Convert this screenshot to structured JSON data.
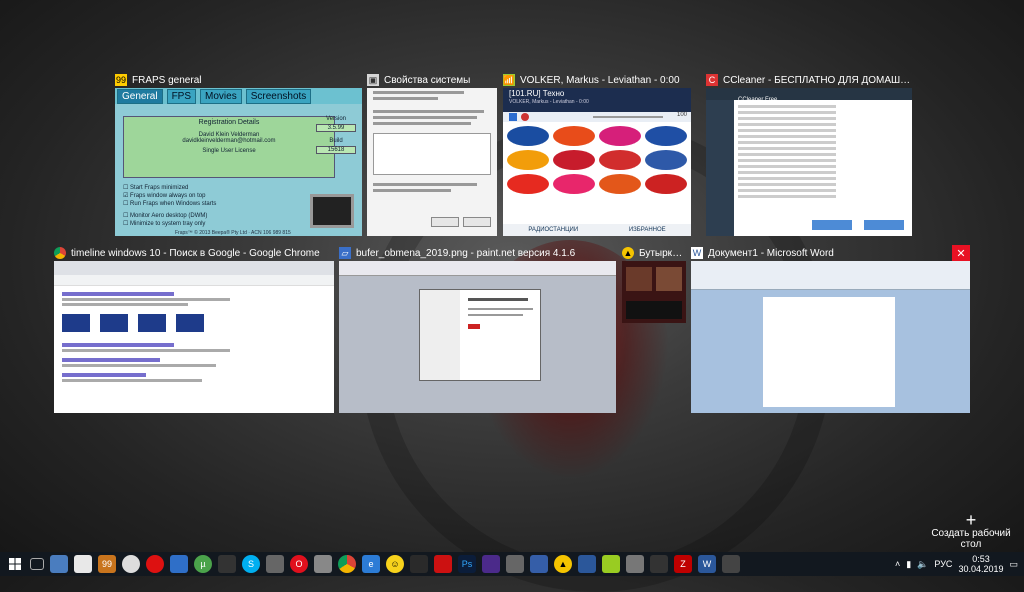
{
  "windows": [
    {
      "title": "FRAPS general",
      "icon": "fraps-icon"
    },
    {
      "title": "Свойства системы",
      "icon": "system-icon"
    },
    {
      "title": "VOLKER, Markus - Leviathan - 0:00",
      "icon": "radio-icon"
    },
    {
      "title": "CCleaner - БЕСПЛАТНО ДЛЯ ДОМАШНЕГО ИСПОЛЬЗО...",
      "icon": "ccleaner-icon"
    },
    {
      "title": "timeline windows 10 - Поиск в Google - Google Chrome",
      "icon": "chrome-icon"
    },
    {
      "title": "bufer_obmena_2019.png - paint.net версия 4.1.6",
      "icon": "paintnet-icon"
    },
    {
      "title": "Бутырка...",
      "icon": "music-icon"
    },
    {
      "title": "Документ1 - Microsoft Word",
      "icon": "word-icon"
    }
  ],
  "fraps": {
    "tabs": [
      "General",
      "FPS",
      "Movies",
      "Screenshots"
    ],
    "panel_title": "Registration Details",
    "owner": "David Klein Velderman",
    "email": "davidkleinvelderman@hotmail.com",
    "license": "Single User License",
    "version_label": "Version",
    "version": "3.5.99",
    "build_label": "Build",
    "build": "15618",
    "options": [
      "Start Fraps minimized",
      "Fraps window always on top",
      "Run Fraps when Windows starts",
      "Monitor Aero desktop (DWM)",
      "Minimize to system tray only"
    ],
    "copyright": "Fraps™ © 2013 Beepa® Pty Ltd · ACN 106 989 815"
  },
  "radio": {
    "station": "[101.RU] Техно",
    "track": "VOLKER, Markus - Leviathan - 0:00",
    "volume": "100",
    "tabs": [
      "РАДИОСТАНЦИИ",
      "ИЗБРАННОЕ"
    ]
  },
  "ccleaner": {
    "title": "CCleaner Free"
  },
  "new_desktop": {
    "label": "Создать рабочий стол"
  },
  "taskbar": {
    "lang": "РУС",
    "time": "0:53",
    "date": "30.04.2019"
  },
  "colors": {
    "close": "#e81123",
    "taskbar": "#12181f"
  }
}
